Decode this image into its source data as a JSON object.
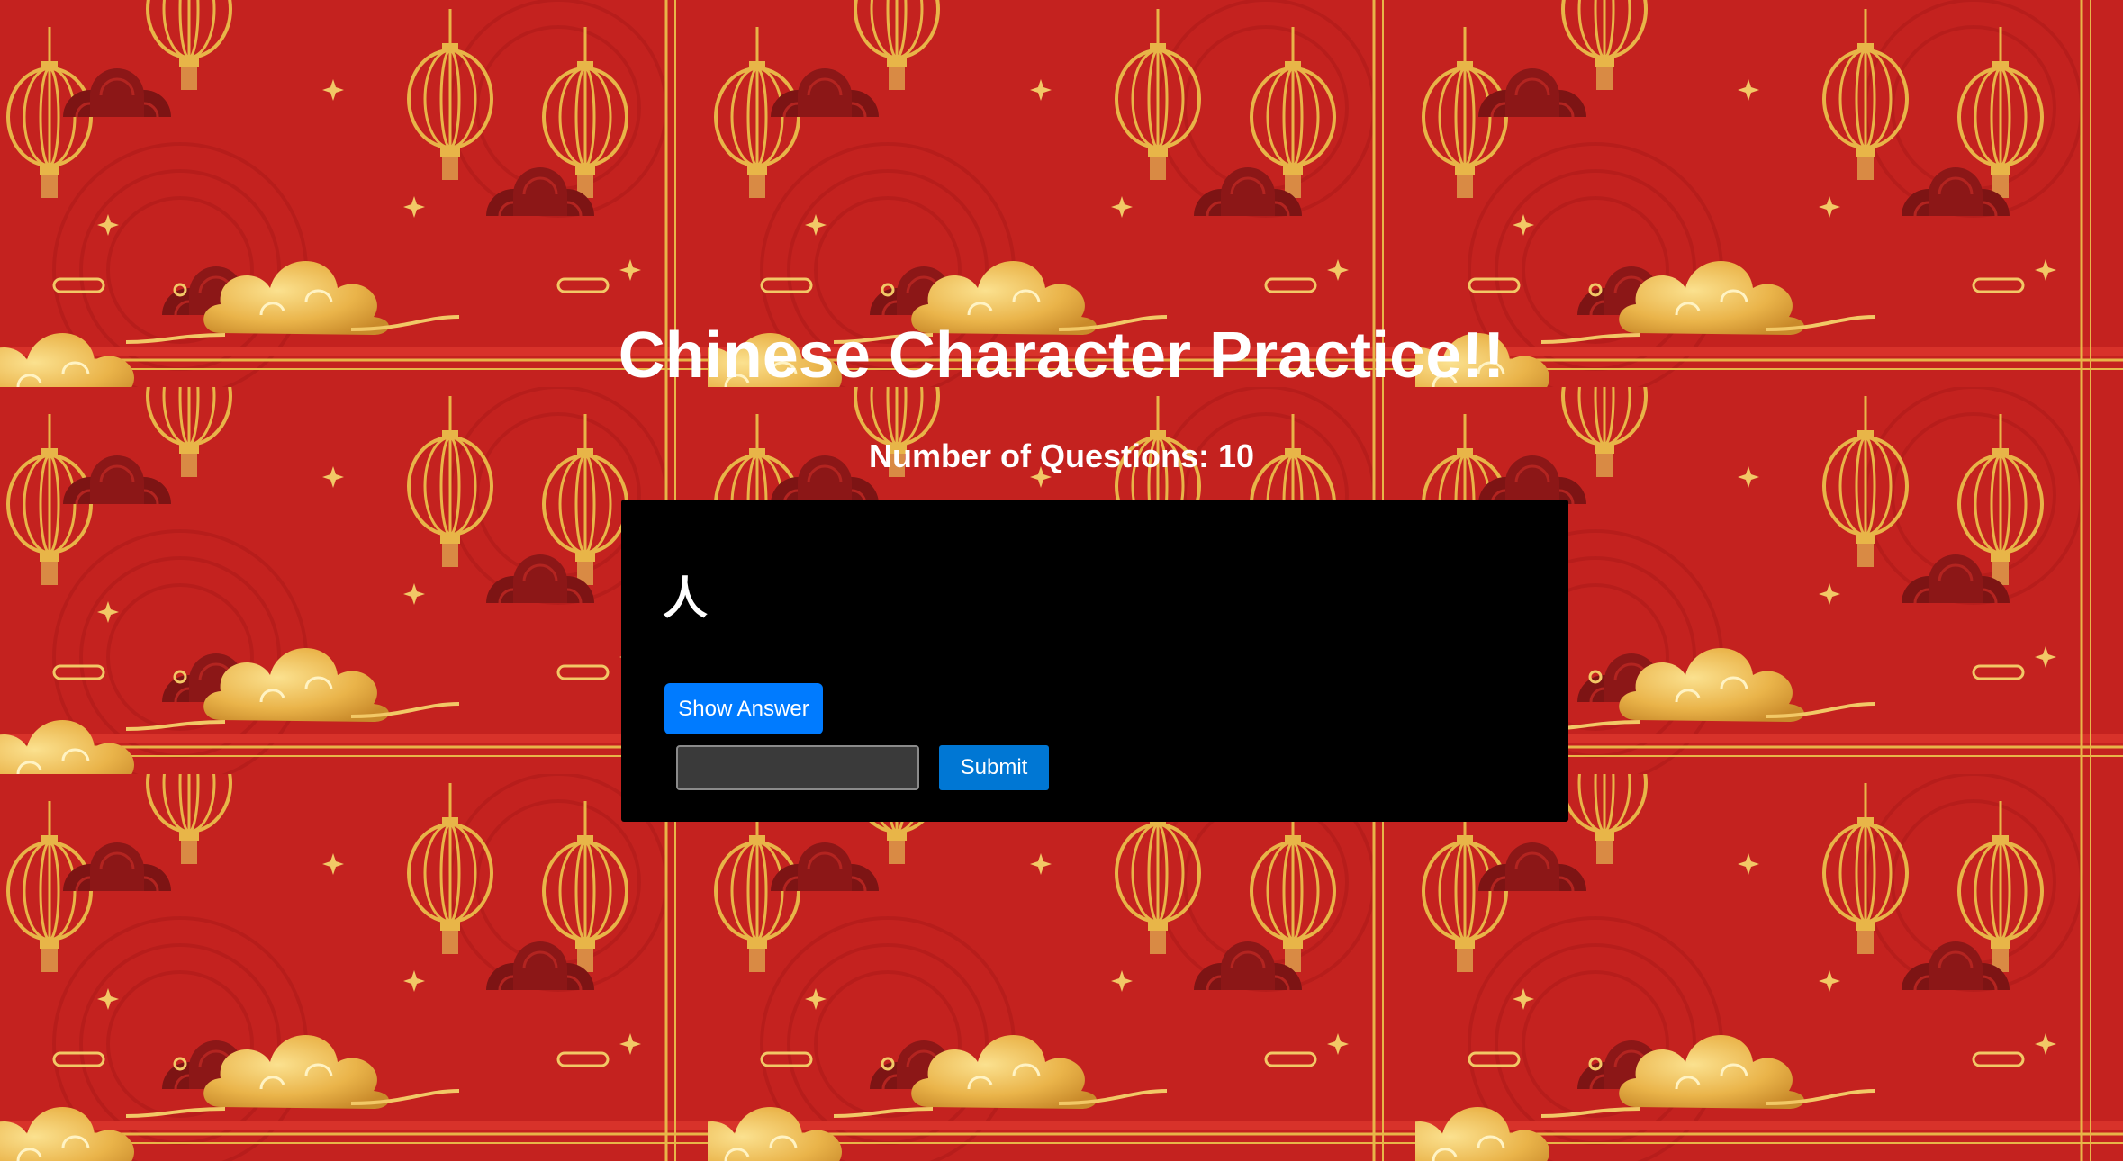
{
  "header": {
    "title": "Chinese Character Practice!!",
    "question_count": "Number of Questions: 10"
  },
  "card": {
    "character": "人",
    "show_answer_label": "Show Answer",
    "answer_input_value": "",
    "submit_label": "Submit"
  },
  "colors": {
    "background_red": "#c4221f",
    "lantern_gold": "#e8b548",
    "card_background": "#000000",
    "show_answer_button": "#007bff",
    "submit_button": "#0077d4",
    "input_background": "#3a3a3a"
  },
  "background": {
    "pattern": "chinese-new-year-lanterns-clouds",
    "icons": [
      "lantern-icon",
      "cloud-icon",
      "scallop-wave-icon",
      "sparkle-icon"
    ]
  }
}
